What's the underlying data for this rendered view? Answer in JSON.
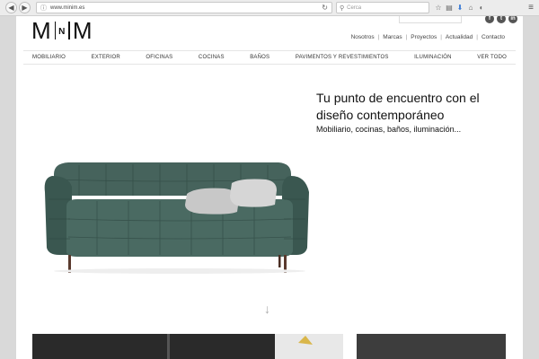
{
  "browser": {
    "url": "www.minim.es",
    "search_placeholder": "Cerca"
  },
  "site": {
    "logo_big_left": "M",
    "logo_small": "N",
    "logo_big_right": "M",
    "social": [
      "f",
      "t",
      "in"
    ],
    "topnav": [
      "Nosotros",
      "Marcas",
      "Proyectos",
      "Actualidad",
      "Contacto"
    ],
    "categories": [
      "MOBILIARIO",
      "EXTERIOR",
      "OFICINAS",
      "COCINAS",
      "BAÑOS",
      "PAVIMENTOS Y REVESTIMIENTOS",
      "ILUMINACIÓN",
      "VER TODO"
    ]
  },
  "hero": {
    "title": "Tu punto de encuentro con el diseño contemporáneo",
    "subtitle": "Mobiliario, cocinas, baños, iluminación..."
  },
  "colors": {
    "sofa": "#3f5c55",
    "cushion": "#c9c9c9"
  }
}
